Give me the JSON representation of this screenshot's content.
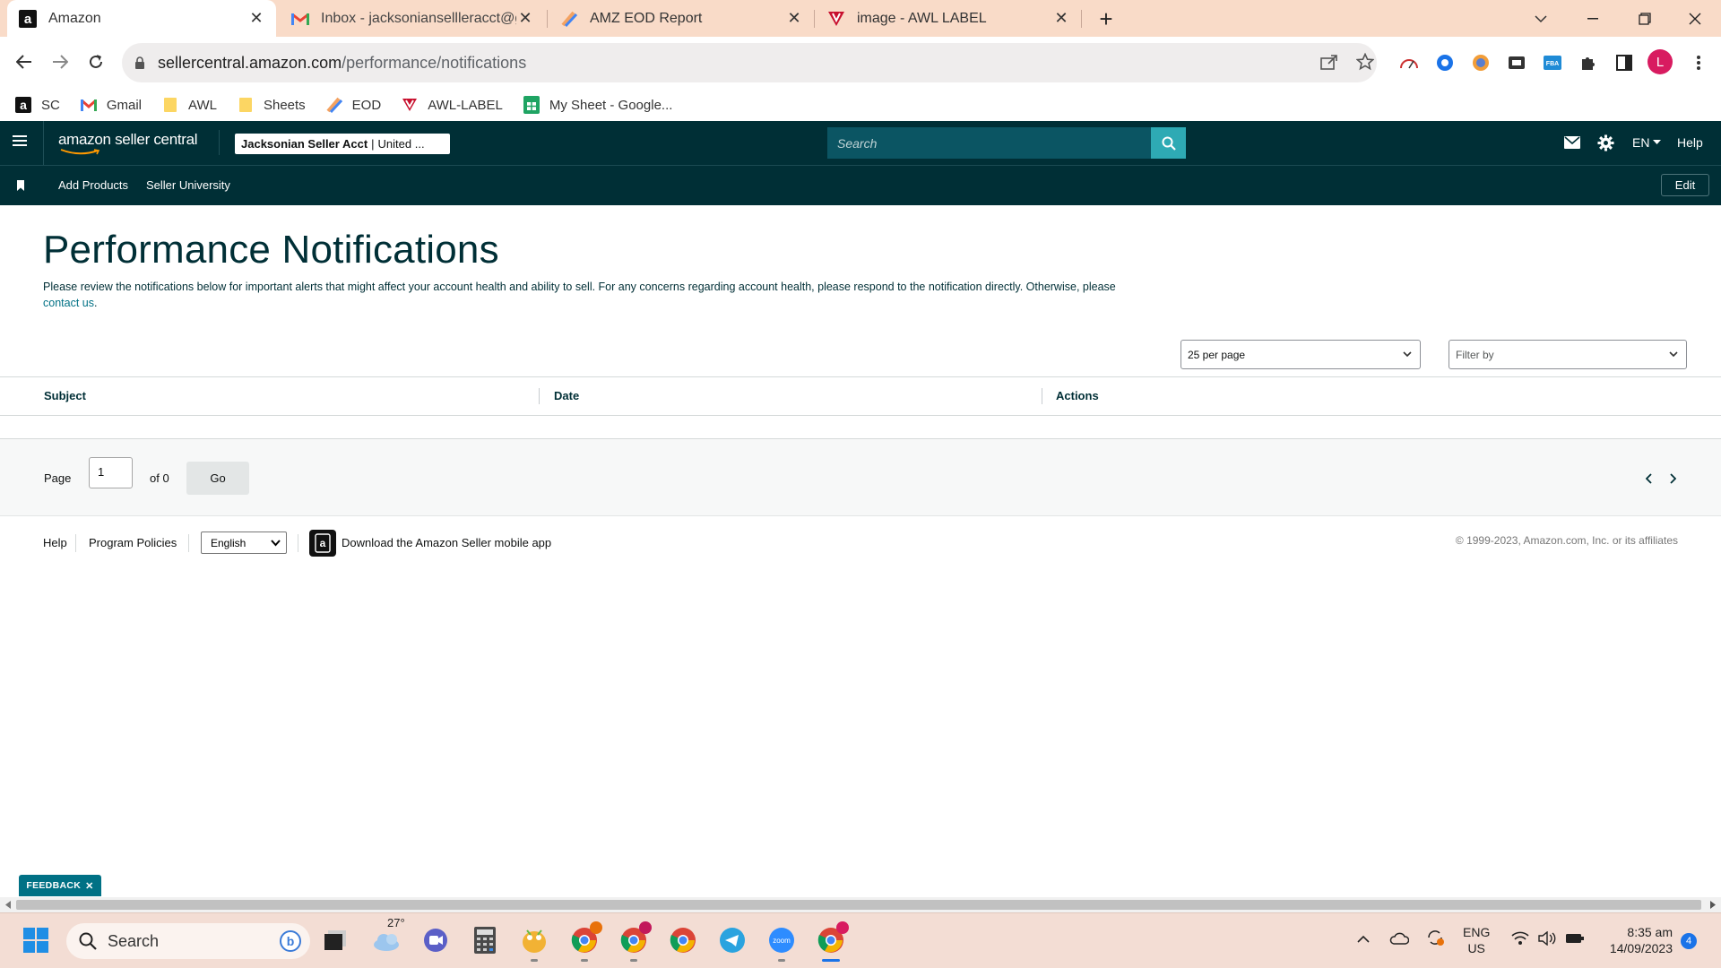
{
  "browser": {
    "tabs": [
      {
        "title": "Amazon",
        "icon": "amazon-a-icon",
        "active": true
      },
      {
        "title": "Inbox - jacksoniansellleracct@gm",
        "icon": "gmail-icon",
        "active": false
      },
      {
        "title": "AMZ EOD Report",
        "icon": "pen-app-icon",
        "active": false
      },
      {
        "title": "image - AWL LABEL",
        "icon": "awl-v-icon",
        "active": false
      }
    ],
    "new_tab": "+",
    "url_host": "sellercentral.amazon.com",
    "url_path": "/performance/notifications",
    "profile_initial": "L",
    "bookmarks": [
      {
        "label": "SC",
        "icon": "amazon-a-icon"
      },
      {
        "label": "Gmail",
        "icon": "gmail-icon"
      },
      {
        "label": "AWL",
        "icon": "folder-icon"
      },
      {
        "label": "Sheets",
        "icon": "folder-icon"
      },
      {
        "label": "EOD",
        "icon": "pen-app-icon"
      },
      {
        "label": "AWL-LABEL",
        "icon": "awl-v-icon"
      },
      {
        "label": "My Sheet - Google...",
        "icon": "google-sheets-icon"
      }
    ]
  },
  "header": {
    "logo": "amazon seller central",
    "account_name": "Jacksonian Seller Acct",
    "account_region": "United ...",
    "search_placeholder": "Search",
    "lang": "EN",
    "help": "Help"
  },
  "subnav": {
    "items": [
      "Add Products",
      "Seller University"
    ],
    "edit": "Edit"
  },
  "main": {
    "title": "Performance Notifications",
    "intro_text": "Please review the notifications below for important alerts that might affect your account health and ability to sell. For any concerns regarding account health, please respond to the notification directly. Otherwise, please ",
    "contact_link": "contact us",
    "intro_end": ".",
    "per_page": "25 per page",
    "filter_placeholder": "Filter by",
    "columns": [
      "Subject",
      "Date",
      "Actions"
    ],
    "pager": {
      "page_label": "Page",
      "page_value": "1",
      "of_label": "of 0",
      "go": "Go"
    }
  },
  "footer": {
    "help": "Help",
    "program_policies": "Program Policies",
    "language": "English",
    "app_text": "Download the Amazon Seller mobile app",
    "copyright": "© 1999-2023, Amazon.com, Inc. or its affiliates"
  },
  "feedback": "FEEDBACK",
  "taskbar": {
    "search": "Search",
    "weather_temp": "27°",
    "lang_top": "ENG",
    "lang_bottom": "US",
    "time": "8:35 am",
    "date": "14/09/2023",
    "notif_count": "4"
  },
  "colors": {
    "sc_dark": "#002f36",
    "sc_teal": "#007185",
    "search_btn": "#2eaab4",
    "tab_bar": "#f9dbc8",
    "taskbar": "#f3ddd4"
  }
}
